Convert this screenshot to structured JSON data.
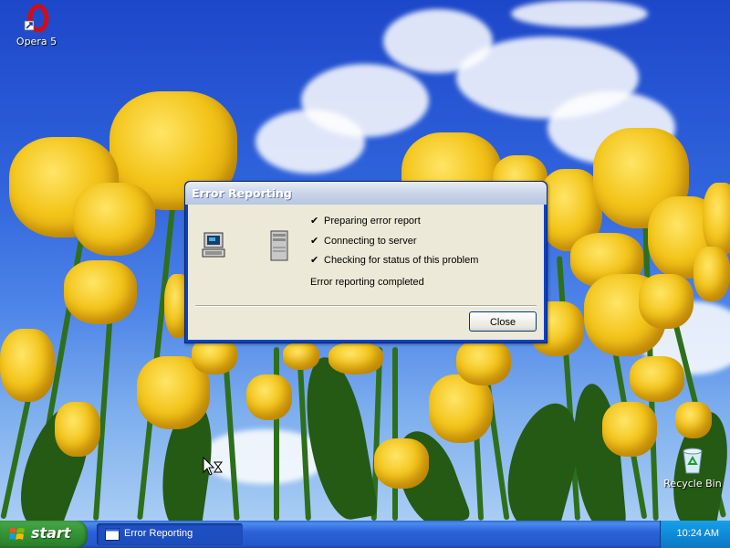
{
  "desktop": {
    "icons": [
      {
        "label": "Opera 5",
        "icon": "opera-icon"
      },
      {
        "label": "Recycle Bin",
        "icon": "recycle-bin-icon"
      }
    ]
  },
  "dialog": {
    "title": "Error Reporting",
    "steps": [
      "Preparing error report",
      "Connecting to server",
      "Checking for status of this problem"
    ],
    "check_glyph": "✔",
    "status": "Error reporting completed",
    "close_label": "Close"
  },
  "taskbar": {
    "start_label": "start",
    "task_item_label": "Error Reporting",
    "clock": "10:24 AM"
  }
}
